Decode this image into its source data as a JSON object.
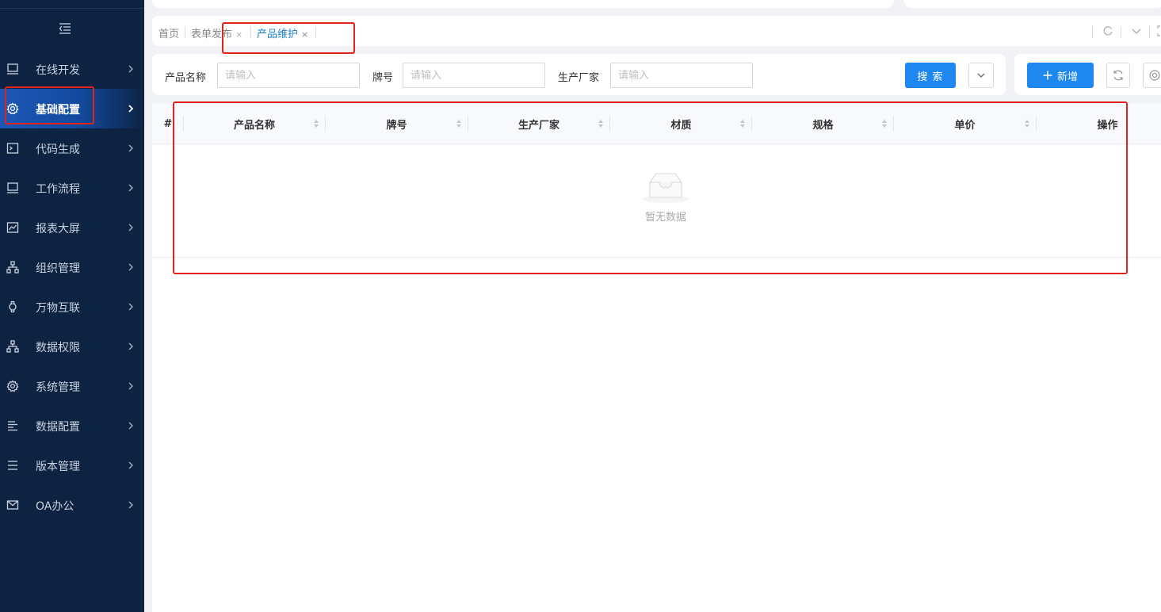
{
  "sidebar": {
    "collapse_icon": "menu-fold-icon",
    "items": [
      {
        "label": "在线开发",
        "icon": "monitor-icon"
      },
      {
        "label": "基础配置",
        "icon": "gear-icon",
        "active": true
      },
      {
        "label": "代码生成",
        "icon": "terminal-icon"
      },
      {
        "label": "工作流程",
        "icon": "monitor-icon"
      },
      {
        "label": "报表大屏",
        "icon": "line-chart-icon"
      },
      {
        "label": "组织管理",
        "icon": "org-tree-icon"
      },
      {
        "label": "万物互联",
        "icon": "watch-icon"
      },
      {
        "label": "数据权限",
        "icon": "org-tree-icon"
      },
      {
        "label": "系统管理",
        "icon": "gear-icon"
      },
      {
        "label": "数据配置",
        "icon": "align-left-icon"
      },
      {
        "label": "版本管理",
        "icon": "list-icon"
      },
      {
        "label": "OA办公",
        "icon": "mail-icon"
      }
    ]
  },
  "tabs": [
    {
      "label": "首页",
      "closable": false
    },
    {
      "label": "表单发布",
      "closable": true
    },
    {
      "label": "产品维护",
      "closable": true,
      "active": true
    }
  ],
  "tab_close_glyph": "×",
  "search": {
    "fields": [
      {
        "label": "产品名称",
        "placeholder": "请输入"
      },
      {
        "label": "牌号",
        "placeholder": "请输入"
      },
      {
        "label": "生产厂家",
        "placeholder": "请输入"
      }
    ],
    "search_button": "搜 索",
    "expand_icon": "chevron-down-icon"
  },
  "actions": {
    "add_button": "新增",
    "refresh_icon": "refresh-icon",
    "settings_icon": "settings-icon"
  },
  "table": {
    "columns": [
      "#",
      "产品名称",
      "牌号",
      "生产厂家",
      "材质",
      "规格",
      "单价",
      "操作"
    ],
    "rows": [],
    "empty_text": "暂无数据"
  },
  "colors": {
    "sidebar_bg": "#0d2342",
    "primary": "#1e88f0",
    "active_tab": "#1a84d4",
    "highlight": "#e0231c"
  }
}
